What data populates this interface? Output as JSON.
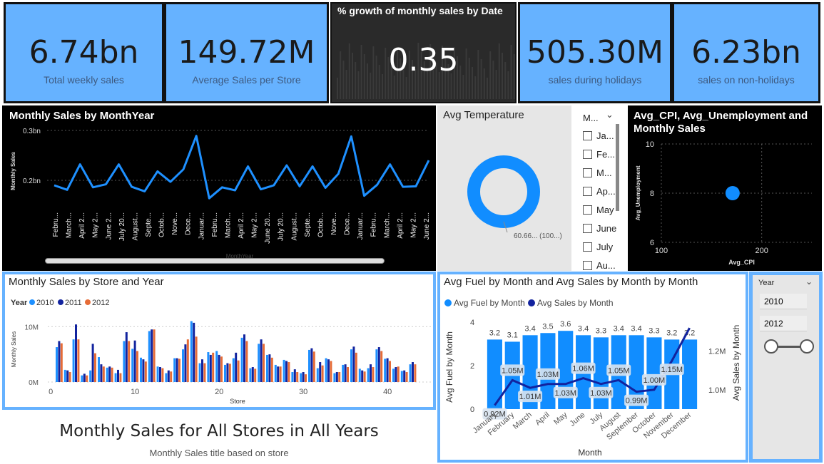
{
  "kpis": [
    {
      "value": "6.74bn",
      "label": "Total weekly sales"
    },
    {
      "value": "149.72M",
      "label": "Average Sales per Store"
    },
    {
      "value": "505.30M",
      "label": "sales during holidays"
    },
    {
      "value": "6.23bn",
      "label": "sales on non-holidays"
    }
  ],
  "growth_card": {
    "title": "% growth of monthly sales by Date",
    "value": "0.35"
  },
  "colors": {
    "kpi_bg": "#66b2ff",
    "line": "#1e90ff",
    "dark_blue": "#12239e",
    "orange": "#e66c37",
    "bar_blue": "#118dff"
  },
  "slicer_month": {
    "header": "M...",
    "items": [
      "Ja...",
      "Fe...",
      "M...",
      "Ap...",
      "May",
      "June",
      "July",
      "Au..."
    ]
  },
  "slicer_year": {
    "header": "Year",
    "from": "2010",
    "to": "2012"
  },
  "footer": {
    "title": "Monthly Sales for All Stores in All Years",
    "subtitle": "Monthly Sales title based on store"
  },
  "chart_data": [
    {
      "type": "line",
      "title": "Monthly Sales by MonthYear",
      "xlabel": "MonthYear",
      "ylabel": "Monthly Sales",
      "y_ticks": [
        "0.3bn",
        "0.2bn"
      ],
      "x": [
        "Febru...",
        "March...",
        "April 2...",
        "May 2...",
        "June 2...",
        "July 20...",
        "August...",
        "Septe...",
        "Octob...",
        "Nove...",
        "Dece...",
        "Januar...",
        "Febru...",
        "March...",
        "April 2...",
        "May 2...",
        "June 20...",
        "July 20...",
        "August...",
        "Septe...",
        "Octob...",
        "Nove...",
        "Dece...",
        "Januar...",
        "Febru...",
        "March...",
        "April 2...",
        "May 2...",
        "June 2..."
      ],
      "values": [
        0.19,
        0.181,
        0.232,
        0.186,
        0.192,
        0.232,
        0.187,
        0.178,
        0.218,
        0.197,
        0.222,
        0.289,
        0.164,
        0.186,
        0.18,
        0.228,
        0.182,
        0.19,
        0.23,
        0.188,
        0.228,
        0.185,
        0.213,
        0.288,
        0.169,
        0.191,
        0.232,
        0.187,
        0.188,
        0.24
      ],
      "ylim": [
        0.15,
        0.3
      ]
    },
    {
      "type": "pie",
      "title": "Avg Temperature",
      "slices": [
        {
          "label": "60.66... (100...)",
          "value": 60.66
        }
      ]
    },
    {
      "type": "scatter",
      "title": "Avg_CPI, Avg_Unemployment and Monthly Sales",
      "xlabel": "Avg_CPI",
      "ylabel": "Avg_Unemployment",
      "x_ticks": [
        "100",
        "200"
      ],
      "y_ticks": [
        "10",
        "8",
        "6"
      ],
      "points": [
        {
          "x": 171,
          "y": 8.0
        }
      ],
      "xlim": [
        100,
        250
      ],
      "ylim": [
        6,
        10
      ]
    },
    {
      "type": "bar",
      "title": "Monthly Sales by Store and Year",
      "xlabel": "Store",
      "ylabel": "Monthly Sales",
      "legend_title": "Year",
      "x_ticks": [
        "0",
        "10",
        "20",
        "30",
        "40"
      ],
      "y_ticks": [
        "0M",
        "10M"
      ],
      "series": [
        {
          "name": "2010",
          "values": [
            6.3,
            2.2,
            7.7,
            1.2,
            2.1,
            4.5,
            2.6,
            1.6,
            7.4,
            6.0,
            4.4,
            9.2,
            2.8,
            1.6,
            4.3,
            5.9,
            11.0,
            3.4,
            5.4,
            5.6,
            3.1,
            4.3,
            8.0,
            2.5,
            6.9,
            4.9,
            3.1,
            4.0,
            1.8,
            1.6,
            5.8,
            2.5,
            4.3,
            1.6,
            3.1,
            5.9,
            2.4,
            2.5,
            5.9,
            4.2,
            2.4,
            2.0,
            3.2
          ]
        },
        {
          "name": "2011",
          "values": [
            7.4,
            2.1,
            10.4,
            1.5,
            6.9,
            3.2,
            2.8,
            2.2,
            9.0,
            7.5,
            4.1,
            9.5,
            2.7,
            2.1,
            4.3,
            6.8,
            10.7,
            4.1,
            4.9,
            4.9,
            3.4,
            5.3,
            8.6,
            2.7,
            7.7,
            5.0,
            2.8,
            3.8,
            2.3,
            1.8,
            6.1,
            3.6,
            4.1,
            1.8,
            3.2,
            6.4,
            2.1,
            3.2,
            6.3,
            4.3,
            2.7,
            2.1,
            3.6
          ]
        },
        {
          "name": "2012",
          "values": [
            7.0,
            1.8,
            7.7,
            1.2,
            5.2,
            2.8,
            2.6,
            1.6,
            7.4,
            5.6,
            3.7,
            9.5,
            2.5,
            1.9,
            4.2,
            7.7,
            8.2,
            3.4,
            5.3,
            4.6,
            3.3,
            3.9,
            7.4,
            2.4,
            6.9,
            4.4,
            2.8,
            3.6,
            1.8,
            1.4,
            5.5,
            3.0,
            3.8,
            1.8,
            2.7,
            5.3,
            1.9,
            2.7,
            5.6,
            3.8,
            2.8,
            1.8,
            3.2
          ]
        }
      ],
      "ylim": [
        0,
        13
      ]
    },
    {
      "type": "bar",
      "title": "Avg Fuel by Month and Avg Sales by Month by Month",
      "xlabel": "Month",
      "ylabel": "Avg Fuel by Month",
      "ylabel_right": "Avg Sales by Month",
      "legend": [
        "Avg Fuel by Month",
        "Avg Sales by Month"
      ],
      "categories": [
        "January",
        "February",
        "March",
        "April",
        "May",
        "June",
        "July",
        "August",
        "September",
        "October",
        "November",
        "December"
      ],
      "y_ticks": [
        "4",
        "2",
        "0"
      ],
      "y2_ticks": [
        "1.2M",
        "1.0M"
      ],
      "fuel_labels": [
        "3.2",
        "3.1",
        "3.4",
        "3.5",
        "3.6",
        "3.4",
        "3.3",
        "3.4",
        "3.4",
        "3.3",
        "3.2",
        "3.2"
      ],
      "fuel_values": [
        3.2,
        3.1,
        3.4,
        3.5,
        3.6,
        3.4,
        3.3,
        3.4,
        3.4,
        3.3,
        3.2,
        3.2
      ],
      "sales_labels": [
        "0.92M",
        "1.05M",
        "1.01M",
        "1.03M",
        "1.03M",
        "1.06M",
        "1.03M",
        "1.05M",
        "0.99M",
        "1.00M",
        "1.15M",
        ""
      ],
      "sales_values": [
        0.92,
        1.05,
        1.01,
        1.03,
        1.03,
        1.06,
        1.03,
        1.05,
        0.99,
        1.0,
        1.15,
        1.32
      ],
      "ylim": [
        0,
        4
      ],
      "y2lim": [
        0.9,
        1.35
      ]
    }
  ]
}
